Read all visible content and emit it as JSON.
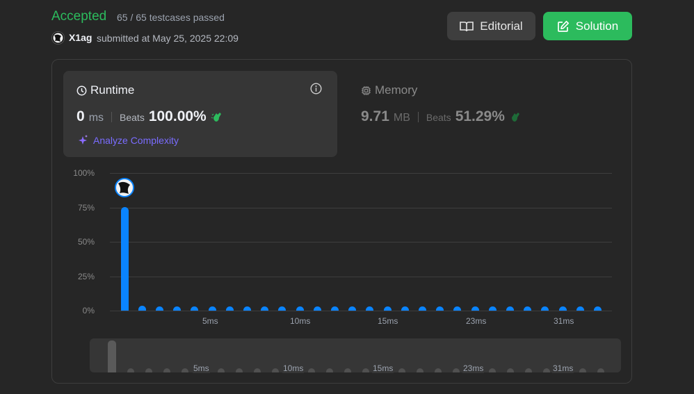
{
  "header": {
    "status": "Accepted",
    "testcases": "65 / 65 testcases passed",
    "username": "X1ag",
    "submitted_text": "submitted at May 25, 2025 22:09"
  },
  "buttons": {
    "editorial": "Editorial",
    "solution": "Solution"
  },
  "runtime": {
    "title": "Runtime",
    "value": "0",
    "unit": "ms",
    "beats_label": "Beats",
    "beats_pct": "100.00%",
    "analyze_label": "Analyze Complexity"
  },
  "memory": {
    "title": "Memory",
    "value": "9.71",
    "unit": "MB",
    "beats_label": "Beats",
    "beats_pct": "51.29%"
  },
  "colors": {
    "accepted": "#2cbb5d",
    "bar": "#0a84ff",
    "analyze": "#7a6cff"
  },
  "chart_data": {
    "type": "bar",
    "y_ticks": [
      "100%",
      "75%",
      "50%",
      "25%",
      "0%"
    ],
    "ylim": [
      0,
      100
    ],
    "x_tick_labels": [
      "5ms",
      "10ms",
      "15ms",
      "23ms",
      "31ms"
    ],
    "values": [
      75.5,
      3.5,
      0.8,
      0.8,
      0.8,
      0.8,
      0.8,
      0.8,
      0.8,
      0.8,
      0.8,
      0.8,
      0.8,
      0.8,
      0.8,
      0.8,
      0.8,
      0.8,
      0.8,
      0.8,
      0.8,
      0.8,
      0.8,
      0.8,
      0.8,
      0.8,
      0.8,
      0.8
    ],
    "highlight_index": 0,
    "grid": true
  },
  "mini_chart": {
    "x_tick_labels": [
      "5ms",
      "10ms",
      "15ms",
      "23ms",
      "31ms"
    ]
  }
}
